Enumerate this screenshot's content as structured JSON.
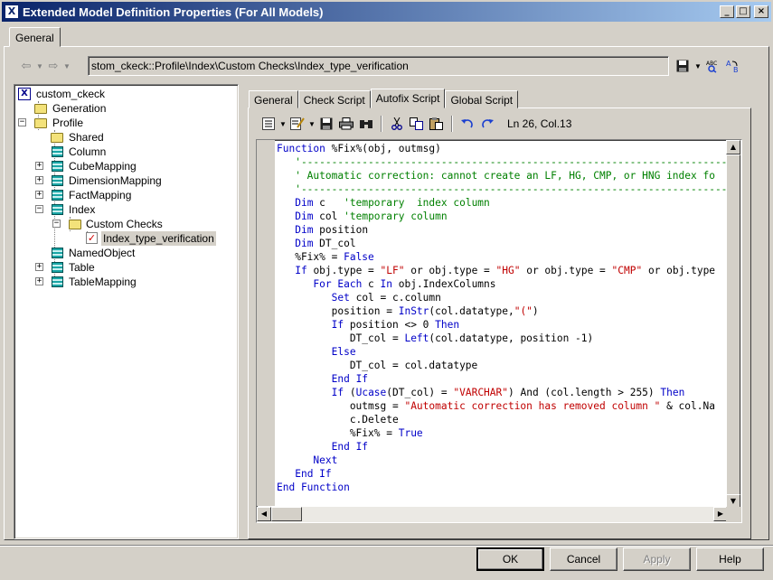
{
  "window": {
    "title": "Extended Model Definition Properties (For All Models)",
    "minimize": "_",
    "maximize": "□",
    "close": "×"
  },
  "outer_tabs": [
    "General"
  ],
  "nav": {
    "path": "stom_ckeck::Profile\\Index\\Custom Checks\\Index_type_verification"
  },
  "tree": {
    "root": "custom_ckeck",
    "items": [
      {
        "label": "custom_ckeck",
        "icon": "model-icon"
      },
      {
        "label": "Generation",
        "icon": "folder-icon"
      },
      {
        "label": "Profile",
        "icon": "folder-icon",
        "expanded": true
      },
      {
        "label": "Shared",
        "icon": "folder-icon"
      },
      {
        "label": "Column",
        "icon": "metaclass-icon"
      },
      {
        "label": "CubeMapping",
        "icon": "metaclass-icon"
      },
      {
        "label": "DimensionMapping",
        "icon": "metaclass-icon"
      },
      {
        "label": "FactMapping",
        "icon": "metaclass-icon"
      },
      {
        "label": "Index",
        "icon": "metaclass-icon",
        "expanded": true
      },
      {
        "label": "Custom Checks",
        "icon": "folder-icon",
        "expanded": true
      },
      {
        "label": "Index_type_verification",
        "icon": "custom-check-icon",
        "selected": true
      },
      {
        "label": "NamedObject",
        "icon": "metaclass-icon"
      },
      {
        "label": "Table",
        "icon": "metaclass-icon"
      },
      {
        "label": "TableMapping",
        "icon": "metaclass-icon"
      }
    ]
  },
  "inner_tabs": [
    "General",
    "Check Script",
    "Autofix Script",
    "Global Script"
  ],
  "active_inner_tab": "Autofix Script",
  "editor": {
    "cursor_position": "Ln 26, Col.13",
    "code_lines": [
      [
        {
          "t": "Function ",
          "c": "kw"
        },
        {
          "t": "%Fix%(obj, outmsg)",
          "c": ""
        }
      ],
      [
        {
          "t": "   '-------------------------------------------------------------------------",
          "c": "cm"
        }
      ],
      [
        {
          "t": "   ' Automatic correction: cannot create an LF, HG, CMP, or HNG index fo",
          "c": "cm"
        }
      ],
      [
        {
          "t": "   '-------------------------------------------------------------------------",
          "c": "cm"
        }
      ],
      [
        {
          "t": "   ",
          "c": ""
        },
        {
          "t": "Dim",
          "c": "kw"
        },
        {
          "t": " c   ",
          "c": ""
        },
        {
          "t": "'temporary  index column",
          "c": "cm"
        }
      ],
      [
        {
          "t": "   ",
          "c": ""
        },
        {
          "t": "Dim",
          "c": "kw"
        },
        {
          "t": " col ",
          "c": ""
        },
        {
          "t": "'temporary column",
          "c": "cm"
        }
      ],
      [
        {
          "t": "   ",
          "c": ""
        },
        {
          "t": "Dim",
          "c": "kw"
        },
        {
          "t": " position",
          "c": ""
        }
      ],
      [
        {
          "t": "   ",
          "c": ""
        },
        {
          "t": "Dim",
          "c": "kw"
        },
        {
          "t": " DT_col",
          "c": ""
        }
      ],
      [
        {
          "t": "   %Fix% = ",
          "c": ""
        },
        {
          "t": "False",
          "c": "kw"
        }
      ],
      [
        {
          "t": "   ",
          "c": ""
        },
        {
          "t": "If",
          "c": "kw"
        },
        {
          "t": " obj.type = ",
          "c": ""
        },
        {
          "t": "\"LF\"",
          "c": "st"
        },
        {
          "t": " or obj.type = ",
          "c": ""
        },
        {
          "t": "\"HG\"",
          "c": "st"
        },
        {
          "t": " or obj.type = ",
          "c": ""
        },
        {
          "t": "\"CMP\"",
          "c": "st"
        },
        {
          "t": " or obj.type",
          "c": ""
        }
      ],
      [
        {
          "t": "      ",
          "c": ""
        },
        {
          "t": "For Each",
          "c": "kw"
        },
        {
          "t": " c ",
          "c": ""
        },
        {
          "t": "In",
          "c": "kw"
        },
        {
          "t": " obj.IndexColumns",
          "c": ""
        }
      ],
      [
        {
          "t": "         ",
          "c": ""
        },
        {
          "t": "Set",
          "c": "kw"
        },
        {
          "t": " col = c.column",
          "c": ""
        }
      ],
      [
        {
          "t": "         position = ",
          "c": ""
        },
        {
          "t": "InStr",
          "c": "fn"
        },
        {
          "t": "(col.datatype,",
          "c": ""
        },
        {
          "t": "\"(\"",
          "c": "st"
        },
        {
          "t": ")",
          "c": ""
        }
      ],
      [
        {
          "t": "         ",
          "c": ""
        },
        {
          "t": "If",
          "c": "kw"
        },
        {
          "t": " position <> 0 ",
          "c": ""
        },
        {
          "t": "Then",
          "c": "kw"
        }
      ],
      [
        {
          "t": "            DT_col = ",
          "c": ""
        },
        {
          "t": "Left",
          "c": "fn"
        },
        {
          "t": "(col.datatype, position -1)",
          "c": ""
        }
      ],
      [
        {
          "t": "         ",
          "c": ""
        },
        {
          "t": "Else",
          "c": "kw"
        }
      ],
      [
        {
          "t": "            DT_col = col.datatype",
          "c": ""
        }
      ],
      [
        {
          "t": "         ",
          "c": ""
        },
        {
          "t": "End If",
          "c": "kw"
        }
      ],
      [
        {
          "t": "         ",
          "c": ""
        },
        {
          "t": "If",
          "c": "kw"
        },
        {
          "t": " (",
          "c": ""
        },
        {
          "t": "Ucase",
          "c": "fn"
        },
        {
          "t": "(DT_col) = ",
          "c": ""
        },
        {
          "t": "\"VARCHAR\"",
          "c": "st"
        },
        {
          "t": ") And (col.length > 255) ",
          "c": ""
        },
        {
          "t": "Then",
          "c": "kw"
        }
      ],
      [
        {
          "t": "            outmsg = ",
          "c": ""
        },
        {
          "t": "\"Automatic correction has removed column \"",
          "c": "st"
        },
        {
          "t": " & col.Na",
          "c": ""
        }
      ],
      [
        {
          "t": "            c.Delete",
          "c": ""
        }
      ],
      [
        {
          "t": "            %Fix% = ",
          "c": ""
        },
        {
          "t": "True",
          "c": "kw"
        }
      ],
      [
        {
          "t": "         ",
          "c": ""
        },
        {
          "t": "End If",
          "c": "kw"
        }
      ],
      [
        {
          "t": "      ",
          "c": ""
        },
        {
          "t": "Next",
          "c": "kw"
        }
      ],
      [
        {
          "t": "   ",
          "c": ""
        },
        {
          "t": "End If",
          "c": "kw"
        }
      ],
      [
        {
          "t": "End Function",
          "c": "kw"
        }
      ]
    ]
  },
  "buttons": {
    "ok": "OK",
    "cancel": "Cancel",
    "apply": "Apply",
    "help": "Help"
  },
  "colors": {
    "keyword": "#0000c8",
    "comment": "#008000",
    "string": "#c00000",
    "title_start": "#0a246a",
    "title_end": "#a6caf0"
  }
}
